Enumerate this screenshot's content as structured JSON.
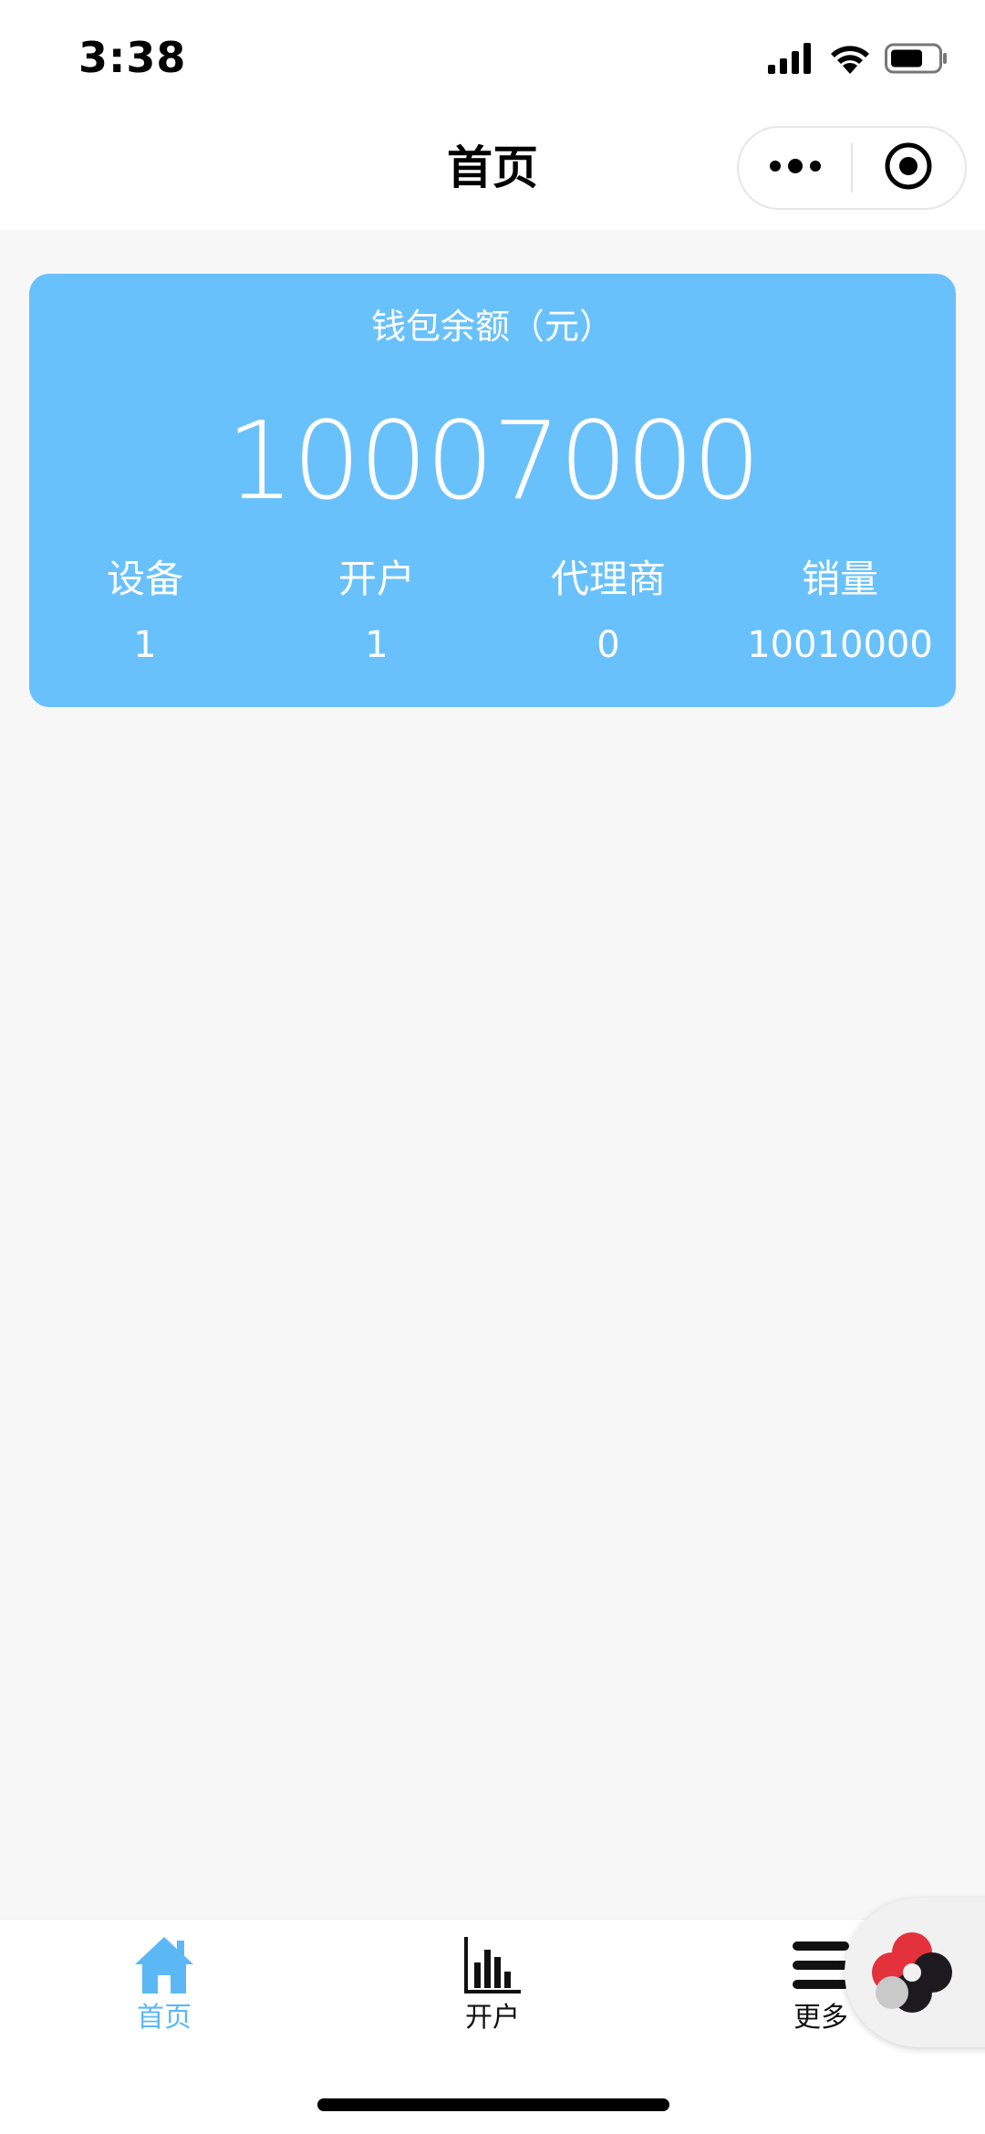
{
  "status_bar": {
    "time": "3:38"
  },
  "nav": {
    "title": "首页"
  },
  "wallet": {
    "label": "钱包余额（元）",
    "amount": "10007000"
  },
  "stats": [
    {
      "label": "设备",
      "value": "1"
    },
    {
      "label": "开户",
      "value": "1"
    },
    {
      "label": "代理商",
      "value": "0"
    },
    {
      "label": "销量",
      "value": "10010000"
    }
  ],
  "tabs": [
    {
      "label": "首页",
      "icon": "home-icon",
      "active": true
    },
    {
      "label": "开户",
      "icon": "bar-chart-icon",
      "active": false
    },
    {
      "label": "更多",
      "icon": "menu-icon",
      "active": false
    }
  ],
  "colors": {
    "accent": "#69c1fb",
    "tab_active": "#5bb8f5",
    "tab_inactive": "#111111",
    "background": "#f7f7f7"
  }
}
